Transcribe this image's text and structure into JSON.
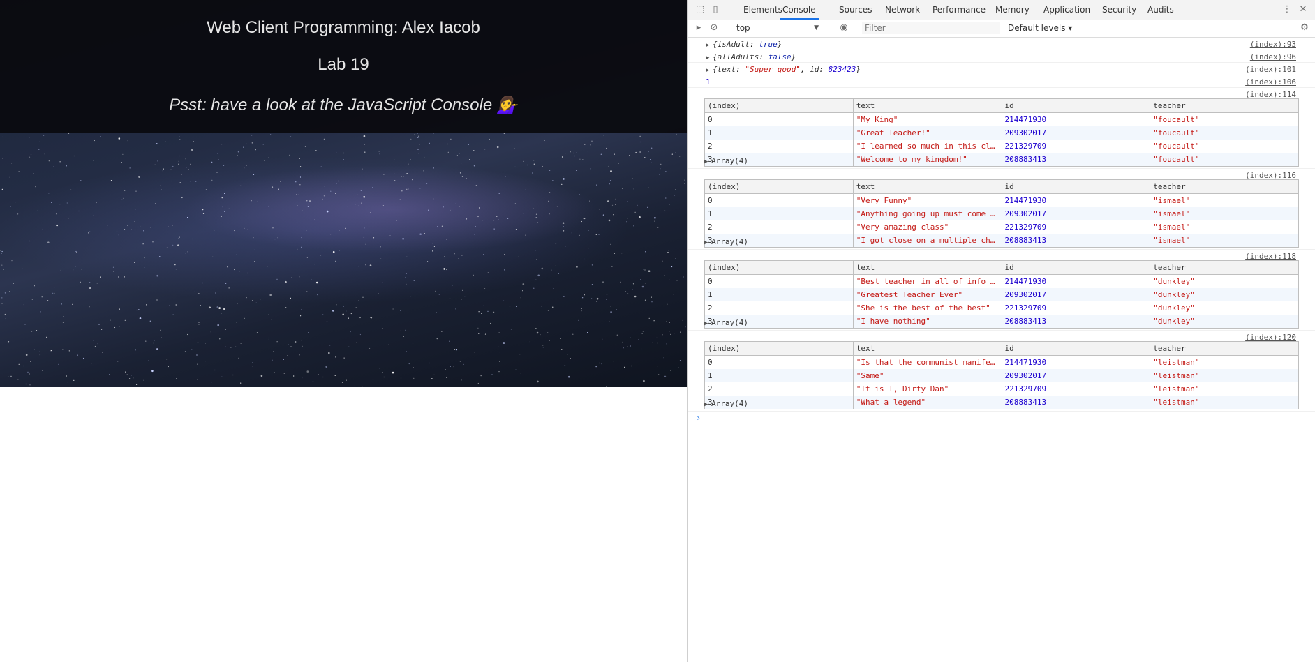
{
  "page": {
    "title": "Web Client Programming: Alex Iacob",
    "lab": "Lab 19",
    "hint": "Psst: have a look at the JavaScript Console 💁‍♀️"
  },
  "devtools": {
    "tabs": [
      "Elements",
      "Console",
      "Sources",
      "Network",
      "Performance",
      "Memory",
      "Application",
      "Security",
      "Audits"
    ],
    "active_tab": "Console",
    "context": "top",
    "filter_placeholder": "Filter",
    "levels": "Default levels ▾",
    "messages": {
      "m1": {
        "key": "isAdult",
        "value": "true",
        "source": "(index):93"
      },
      "m2": {
        "key": "allAdults",
        "value": "false",
        "source": "(index):96"
      },
      "m3": {
        "text_key": "text",
        "text_value": "\"Super good\"",
        "id_key": "id",
        "id_value": "823423",
        "source": "(index):101"
      },
      "m4": {
        "value": "1",
        "source": "(index):106"
      }
    },
    "table_headers": [
      "(index)",
      "text",
      "id",
      "teacher"
    ],
    "array_label": "Array(4)",
    "tables": [
      {
        "source": "(index):114",
        "rows": [
          [
            "0",
            "\"My King\"",
            "214471930",
            "\"foucault\""
          ],
          [
            "1",
            "\"Great Teacher!\"",
            "209302017",
            "\"foucault\""
          ],
          [
            "2",
            "\"I learned so much in this cl…",
            "221329709",
            "\"foucault\""
          ],
          [
            "3",
            "\"Welcome to my kingdom!\"",
            "208883413",
            "\"foucault\""
          ]
        ]
      },
      {
        "source": "(index):116",
        "rows": [
          [
            "0",
            "\"Very Funny\"",
            "214471930",
            "\"ismael\""
          ],
          [
            "1",
            "\"Anything going up must come …",
            "209302017",
            "\"ismael\""
          ],
          [
            "2",
            "\"Very amazing class\"",
            "221329709",
            "\"ismael\""
          ],
          [
            "3",
            "\"I got close on a multiple ch…",
            "208883413",
            "\"ismael\""
          ]
        ]
      },
      {
        "source": "(index):118",
        "rows": [
          [
            "0",
            "\"Best teacher in all of info …",
            "214471930",
            "\"dunkley\""
          ],
          [
            "1",
            "\"Greatest Teacher Ever\"",
            "209302017",
            "\"dunkley\""
          ],
          [
            "2",
            "\"She is the best of the best\"",
            "221329709",
            "\"dunkley\""
          ],
          [
            "3",
            "\"I have nothing\"",
            "208883413",
            "\"dunkley\""
          ]
        ]
      },
      {
        "source": "(index):120",
        "rows": [
          [
            "0",
            "\"Is that the communist manife…",
            "214471930",
            "\"leistman\""
          ],
          [
            "1",
            "\"Same\"",
            "209302017",
            "\"leistman\""
          ],
          [
            "2",
            "\"It is I, Dirty Dan\"",
            "221329709",
            "\"leistman\""
          ],
          [
            "3",
            "\"What a legend\"",
            "208883413",
            "\"leistman\""
          ]
        ]
      }
    ]
  }
}
